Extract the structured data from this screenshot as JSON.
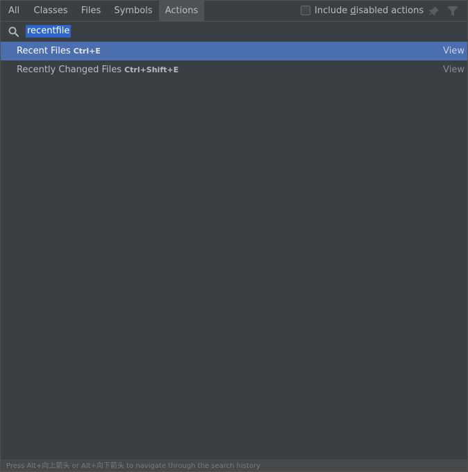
{
  "tabs": [
    {
      "label": "All",
      "active": false
    },
    {
      "label": "Classes",
      "active": false
    },
    {
      "label": "Files",
      "active": false
    },
    {
      "label": "Symbols",
      "active": false
    },
    {
      "label": "Actions",
      "active": true
    }
  ],
  "include_disabled": {
    "checked": false,
    "label_pre": "Include ",
    "label_mnemonic": "d",
    "label_post": "isabled actions"
  },
  "toolbar_icons": [
    "pin-icon",
    "filter-icon"
  ],
  "search": {
    "icon": "search-icon",
    "value": "recentfile"
  },
  "results": [
    {
      "name": "Recent Files",
      "shortcut": "Ctrl+E",
      "group": "View",
      "selected": true
    },
    {
      "name": "Recently Changed Files",
      "shortcut": "Ctrl+Shift+E",
      "group": "View",
      "selected": false
    }
  ],
  "footer_hint": "Press Alt+向上箭头 or Alt+向下箭头 to navigate through the search history",
  "colors": {
    "background": "#3c3f41",
    "selection": "#4b6eaf",
    "search_highlight": "#2f65ca",
    "text": "#bbbbbb"
  }
}
